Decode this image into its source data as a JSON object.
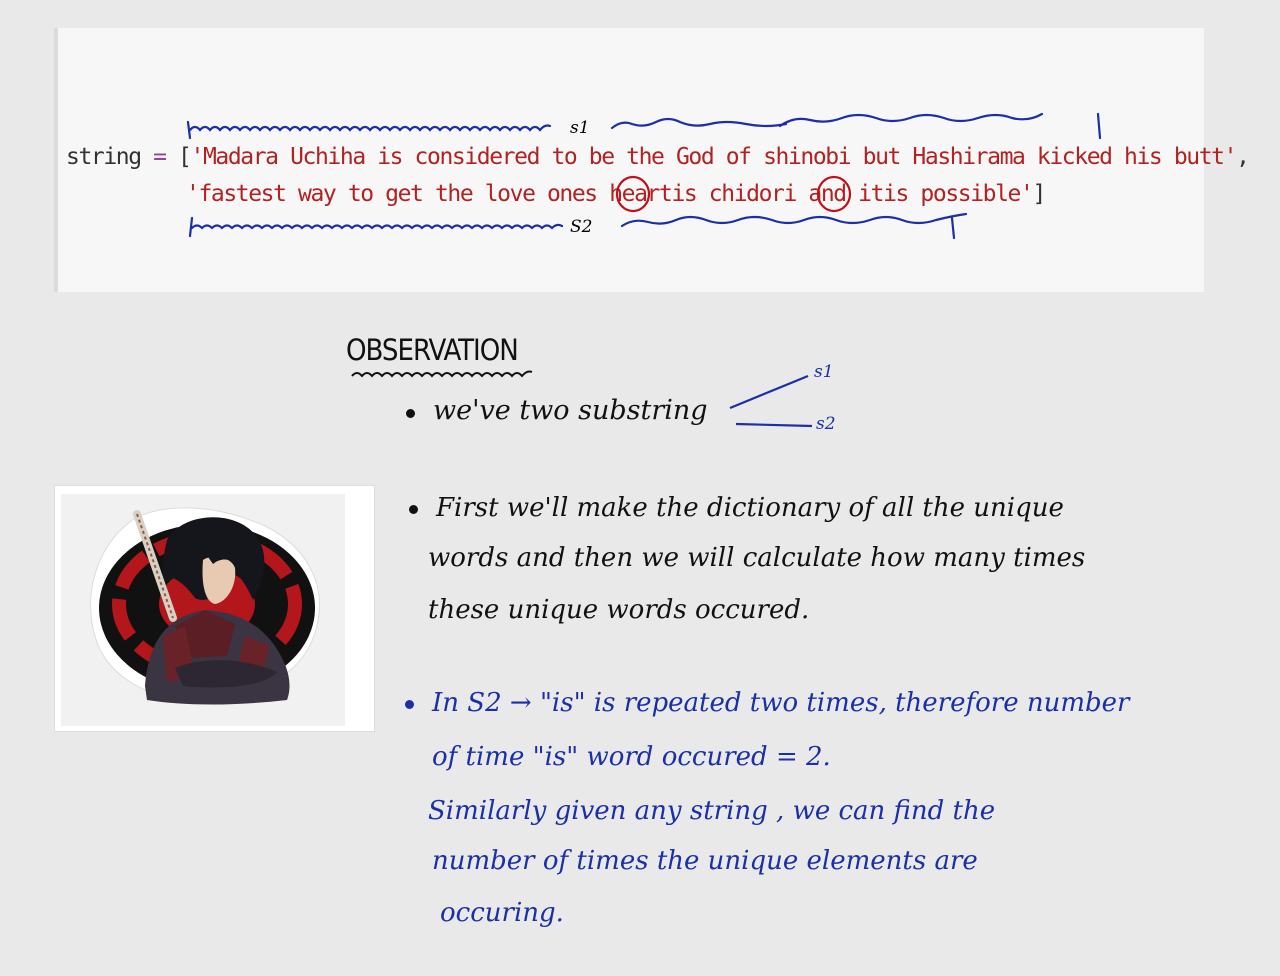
{
  "code": {
    "var_name": "string",
    "equals": "=",
    "open_bracket": "[",
    "string1": "'Madara Uchiha is considered to be the God of shinobi but Hashirama kicked his butt'",
    "comma": ",",
    "string2_part1": "'fastest way to get the love ones heart",
    "highlight1": "is",
    "string2_part2": " chidori and it",
    "highlight2": "is",
    "string2_part3": " possible'",
    "close_bracket": "]"
  },
  "annotations": {
    "s1": "s1",
    "s2": "S2"
  },
  "observation": {
    "heading": "OBSERVATION",
    "bullet1": "we've two substring",
    "branch_s1": "s1",
    "branch_s2": "s2",
    "bullet2_line1": "First we'll make the dictionary of all the unique",
    "bullet2_line2": "words and then we will calculate how many times",
    "bullet2_line3": "these unique words occured.",
    "bullet3_line1": "In S2 → \"is\" is repeated two times, therefore number",
    "bullet3_line2": "of time \"is\" word occured = 2.",
    "bullet3_line3": "Similarly given any string , we can find the",
    "bullet3_line4": "number of times the unique elements are",
    "bullet3_line5": "occuring."
  },
  "colors": {
    "ink_black": "#111111",
    "ink_blue": "#1a2fa8",
    "string_red": "#b22222",
    "circle_red": "#c0101a"
  }
}
